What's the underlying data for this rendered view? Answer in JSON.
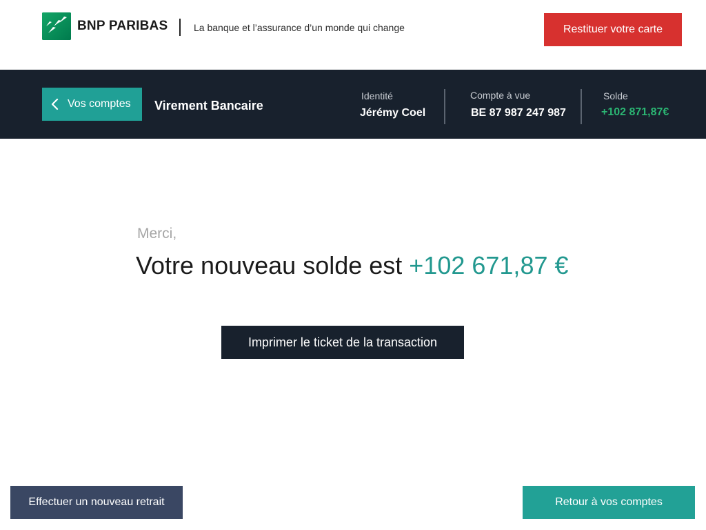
{
  "header": {
    "brand": "BNP PARIBAS",
    "tagline": "La banque et l’assurance d’un monde qui change",
    "return_card_label": "Restituer votre carte"
  },
  "nav": {
    "back_label": "Vos comptes",
    "title": "Virement Bancaire",
    "identity": {
      "label": "Identité",
      "value": "Jérémy Coel"
    },
    "account": {
      "label": "Compte à vue",
      "value": "BE 87 987 247 987"
    },
    "balance": {
      "label": "Solde",
      "value": "+102 871,87€"
    }
  },
  "main": {
    "thanks": "Merci,",
    "balance_text": "Votre nouveau solde est ",
    "new_balance": "+102 671,87  €",
    "print_label": "Imprimer le ticket de la transaction"
  },
  "footer": {
    "new_withdrawal_label": "Effectuer un nouveau retrait",
    "back_accounts_label": "Retour à vos comptes"
  },
  "colors": {
    "brand_green": "#00915a",
    "danger_red": "#d7312f",
    "navbar_dark": "#18212d",
    "teal": "#20a096",
    "positive_green": "#2bb673",
    "navy_button": "#3a4763"
  }
}
